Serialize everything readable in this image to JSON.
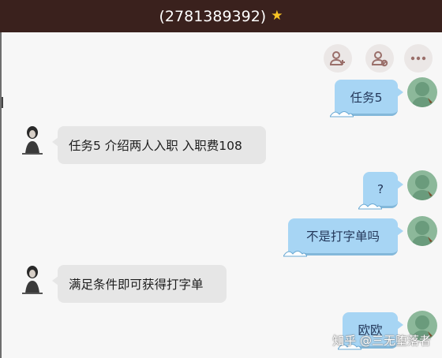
{
  "header": {
    "title": "(2781389392)",
    "badge_icon": "star-icon"
  },
  "toolbar": {
    "buttons": [
      {
        "icon": "add-friend-icon"
      },
      {
        "icon": "block-user-icon"
      },
      {
        "icon": "more-icon"
      }
    ]
  },
  "messages": [
    {
      "direction": "out",
      "text": "任务5"
    },
    {
      "direction": "in",
      "text": "任务5 介绍两人入职 入职费108"
    },
    {
      "direction": "out",
      "text": "?"
    },
    {
      "direction": "out",
      "text": "不是打字单吗"
    },
    {
      "direction": "in",
      "text": "满足条件即可获得打字单"
    },
    {
      "direction": "out",
      "text": "欧欧"
    }
  ],
  "watermark": "知乎 @三无堕落者",
  "colors": {
    "titlebar": "#3a211d",
    "outgoing_bubble": "#a7d5f4",
    "incoming_bubble": "#e6e6e6",
    "avatar": "#8cb89a",
    "star": "#f7c325"
  }
}
